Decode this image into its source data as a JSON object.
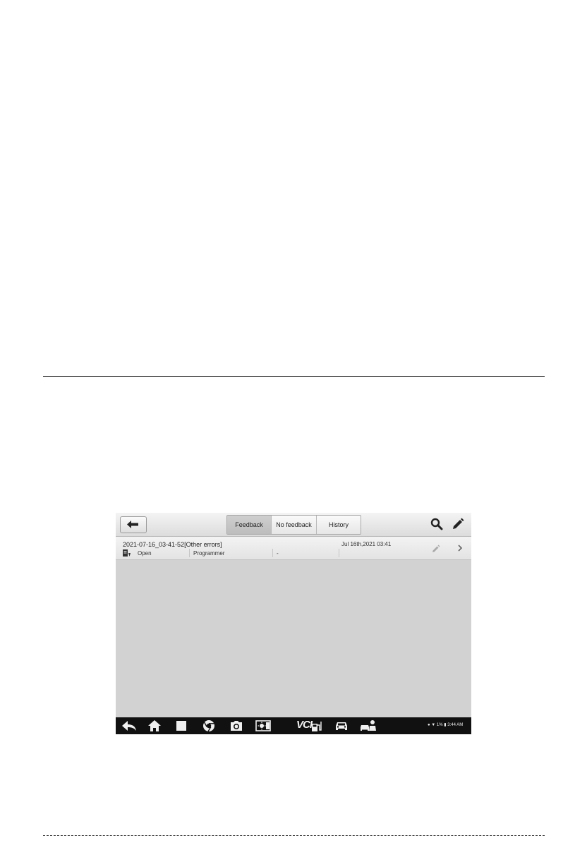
{
  "toolbar": {
    "tabs": [
      "Feedback",
      "No feedback",
      "History"
    ],
    "active_tab": "Feedback"
  },
  "record": {
    "title": "2021-07-16_03-41-52[Other errors]",
    "date": "Jul 16th,2021 03:41",
    "status": "Open",
    "type": "Programmer",
    "extra": "-"
  },
  "status_bar": {
    "battery": "1%",
    "time": "3:44 AM"
  },
  "nav_icons": [
    "back-arrow-icon",
    "home-icon",
    "recent-apps-icon",
    "chrome-icon",
    "camera-icon",
    "display-settings-icon",
    "vci-icon",
    "gas-pump-icon",
    "car-icon",
    "car-person-icon"
  ],
  "colors": {
    "screen_background": "#d2d2d2",
    "active_tab": "#c6c6c6",
    "navbar": "#111111"
  }
}
